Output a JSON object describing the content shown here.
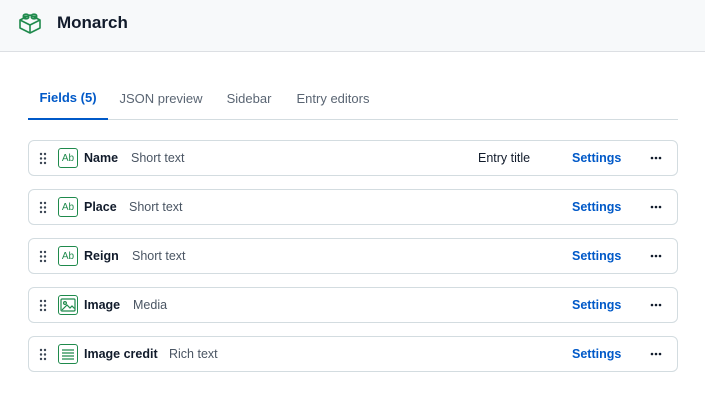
{
  "app": {
    "title": "Monarch",
    "logo_icon": "lego-brick-icon",
    "accent": "#1f8a4c"
  },
  "tabs": [
    {
      "label": "Fields (5)",
      "active": true
    },
    {
      "label": "JSON preview",
      "active": false
    },
    {
      "label": "Sidebar",
      "active": false
    },
    {
      "label": "Entry editors",
      "active": false
    }
  ],
  "fields": [
    {
      "name": "Name",
      "type": "Short text",
      "icon": "text-ab-icon",
      "icon_text": "Ab",
      "entry_title_label": "Entry title",
      "settings_label": "Settings"
    },
    {
      "name": "Place",
      "type": "Short text",
      "icon": "text-ab-icon",
      "icon_text": "Ab",
      "settings_label": "Settings"
    },
    {
      "name": "Reign",
      "type": "Short text",
      "icon": "text-ab-icon",
      "icon_text": "Ab",
      "settings_label": "Settings"
    },
    {
      "name": "Image",
      "type": "Media",
      "icon": "image-icon",
      "settings_label": "Settings"
    },
    {
      "name": "Image credit",
      "type": "Rich text",
      "icon": "rich-text-icon",
      "settings_label": "Settings"
    }
  ],
  "colors": {
    "link": "#0059c8",
    "border": "#d3dce0"
  }
}
